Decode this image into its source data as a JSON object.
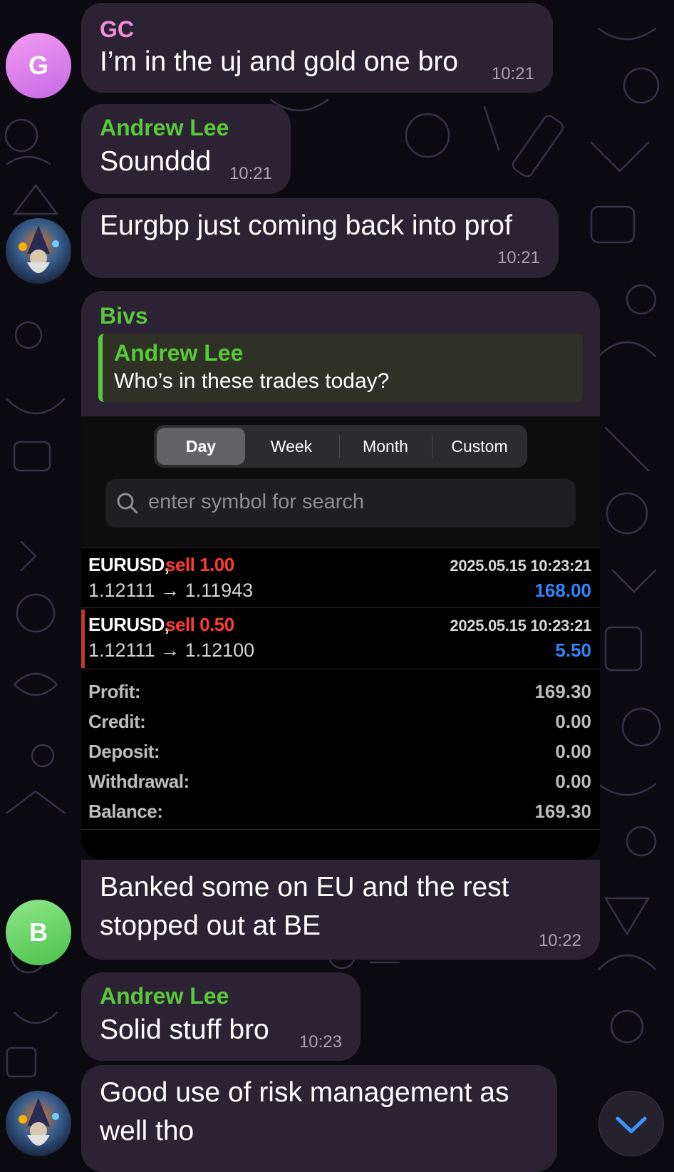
{
  "messages": [
    {
      "sender": "GC",
      "text": "I’m in the uj and gold one bro",
      "time": "10:21",
      "avatar_letter": "G"
    },
    {
      "sender": "Andrew Lee",
      "text": "Sounddd",
      "time": "10:21"
    },
    {
      "text": "Eurgbp just coming back into prof",
      "time": "10:21"
    },
    {
      "sender": "Bivs",
      "reply": {
        "name": "Andrew Lee",
        "text": "Who’s in these trades today?"
      }
    },
    {
      "text_line1": "Banked some on EU and the rest",
      "text_line2": "stopped out at BE",
      "time": "10:22",
      "avatar_letter": "B"
    },
    {
      "sender": "Andrew Lee",
      "text": "Solid stuff bro",
      "time": "10:23"
    },
    {
      "text_line1": "Good use of risk management as",
      "text_line2": "well tho"
    }
  ],
  "colors": {
    "gc_name": "#f08dd6",
    "green_name": "#59c83a",
    "sell_red": "#ff3b30",
    "profit_blue": "#2f86ff",
    "bubble": "#2b2334"
  },
  "screenshot": {
    "tabs": [
      "Day",
      "Week",
      "Month",
      "Custom"
    ],
    "active_tab": "Day",
    "search_placeholder": "enter symbol for search",
    "trades": [
      {
        "symbol": "EURUSD,",
        "side": "sell 1.00",
        "date": "2025.05.15 10:23:21",
        "prices": "1.12111 → 1.11943",
        "profit": "168.00"
      },
      {
        "symbol": "EURUSD,",
        "side": "sell 0.50",
        "date": "2025.05.15 10:23:21",
        "prices": "1.12111 → 1.12100",
        "profit": "5.50"
      }
    ],
    "summary": [
      {
        "label": "Profit:",
        "value": "169.30"
      },
      {
        "label": "Credit:",
        "value": "0.00"
      },
      {
        "label": "Deposit:",
        "value": "0.00"
      },
      {
        "label": "Withdrawal:",
        "value": "0.00"
      },
      {
        "label": "Balance:",
        "value": "169.30"
      }
    ]
  },
  "icons": {
    "scroll_down": "chevron-down-icon",
    "search": "search-icon"
  }
}
